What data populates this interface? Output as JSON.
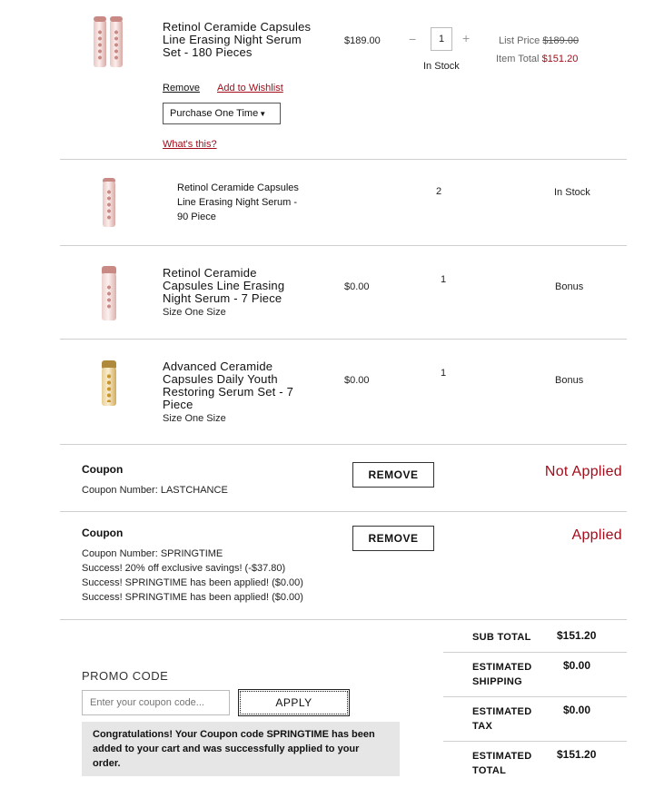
{
  "items": [
    {
      "name": "Retinol Ceramide Capsules Line Erasing Night Serum Set - 180 Pieces",
      "price": "$189.00",
      "qty": "1",
      "stock": "In Stock",
      "list_price_label": "List Price",
      "list_price": "$189.00",
      "item_total_label": "Item Total",
      "item_total": "$151.20",
      "remove_label": "Remove",
      "wishlist_label": "Add to Wishlist",
      "purchase_option": "Purchase One Time",
      "whats_this": "What's this?",
      "minus": "−",
      "plus": "+"
    },
    {
      "name": "Retinol Ceramide Capsules Line Erasing Night Serum - 90 Piece",
      "qty": "2",
      "stock": "In Stock"
    },
    {
      "name": "Retinol Ceramide Capsules Line Erasing Night Serum - 7 Piece",
      "size": "Size One Size",
      "price": "$0.00",
      "qty": "1",
      "status": "Bonus"
    },
    {
      "name": "Advanced Ceramide Capsules Daily Youth Restoring Serum Set - 7 Piece",
      "size": "Size One Size",
      "price": "$0.00",
      "qty": "1",
      "status": "Bonus"
    }
  ],
  "coupons": [
    {
      "title": "Coupon",
      "number": "Coupon Number: LASTCHANCE",
      "remove_label": "REMOVE",
      "status": "Not Applied",
      "messages": []
    },
    {
      "title": "Coupon",
      "number": "Coupon Number: SPRINGTIME",
      "remove_label": "REMOVE",
      "status": "Applied",
      "messages": [
        "Success! 20% off exclusive savings! (-$37.80)",
        "Success! SPRINGTIME has been applied! ($0.00)",
        "Success! SPRINGTIME has been applied! ($0.00)"
      ]
    }
  ],
  "promo": {
    "label": "PROMO CODE",
    "placeholder": "Enter your coupon code...",
    "apply_label": "APPLY",
    "success_message": "Congratulations! Your Coupon code SPRINGTIME has been added to your cart and was successfully applied to your order."
  },
  "summary": {
    "subtotal_label": "SUB TOTAL",
    "subtotal": "$151.20",
    "shipping_label_1": "ESTIMATED",
    "shipping_label_2": "SHIPPING",
    "shipping": "$0.00",
    "tax_label_1": "ESTIMATED",
    "tax_label_2": "TAX",
    "tax": "$0.00",
    "total_label_1": "ESTIMATED",
    "total_label_2": "TOTAL",
    "total": "$151.20"
  },
  "colors": {
    "accent_red": "#a30c1a",
    "capsule_pink": "#c98a86",
    "capsule_gold": "#c9962e"
  }
}
